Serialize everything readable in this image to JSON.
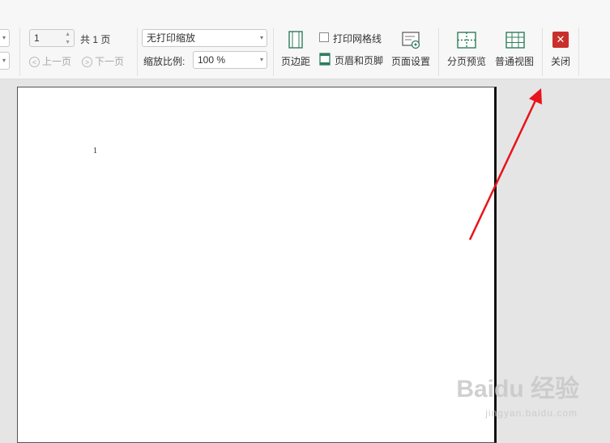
{
  "toolbar": {
    "page_input_value": "1",
    "total_pages": "共 1 页",
    "prev_page": "上一页",
    "next_page": "下一页",
    "scale_mode": "无打印缩放",
    "zoom_label": "缩放比例:",
    "zoom_value": "100 %",
    "margins": "页边距",
    "print_gridlines": "打印网格线",
    "header_footer": "页眉和页脚",
    "page_setup": "页面设置",
    "page_break_preview": "分页预览",
    "normal_view": "普通视图",
    "close": "关闭"
  },
  "document": {
    "page_number": "1"
  },
  "watermark": {
    "brand": "Baidu 经验",
    "url": "jingyan.baidu.com"
  },
  "annotation": {
    "arrow_color": "#e8141b"
  }
}
